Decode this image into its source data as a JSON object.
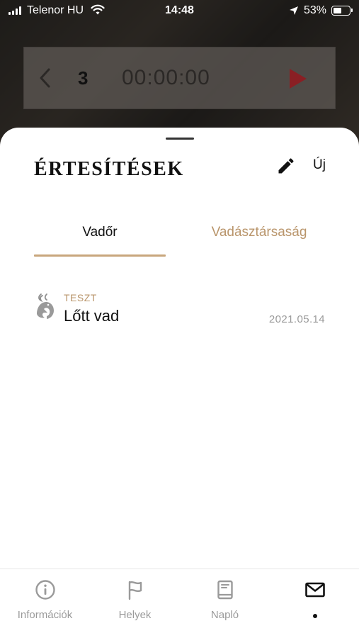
{
  "status_bar": {
    "carrier": "Telenor HU",
    "time": "14:48",
    "battery": "53%",
    "battery_level": 0.53
  },
  "timer": {
    "count": "3",
    "elapsed": "00:00:00"
  },
  "sheet": {
    "title": "ÉRTESÍTÉSEK",
    "new_label": "Új"
  },
  "tabs": [
    {
      "label": "Vadőr",
      "active": true
    },
    {
      "label": "Vadásztársaság",
      "active": false
    }
  ],
  "notifications": [
    {
      "tag": "TESZT",
      "title": "Lőtt vad",
      "date": "2021.05.14",
      "icon": "deer-icon"
    }
  ],
  "bottom_nav": [
    {
      "label": "Információk",
      "icon": "info-icon"
    },
    {
      "label": "Helyek",
      "icon": "flag-icon"
    },
    {
      "label": "Napló",
      "icon": "book-icon"
    },
    {
      "label": "",
      "icon": "mail-icon",
      "active": true
    }
  ],
  "colors": {
    "accent": "#c8a67c",
    "accent_text": "#b9956b",
    "muted": "#9a9a9a"
  }
}
